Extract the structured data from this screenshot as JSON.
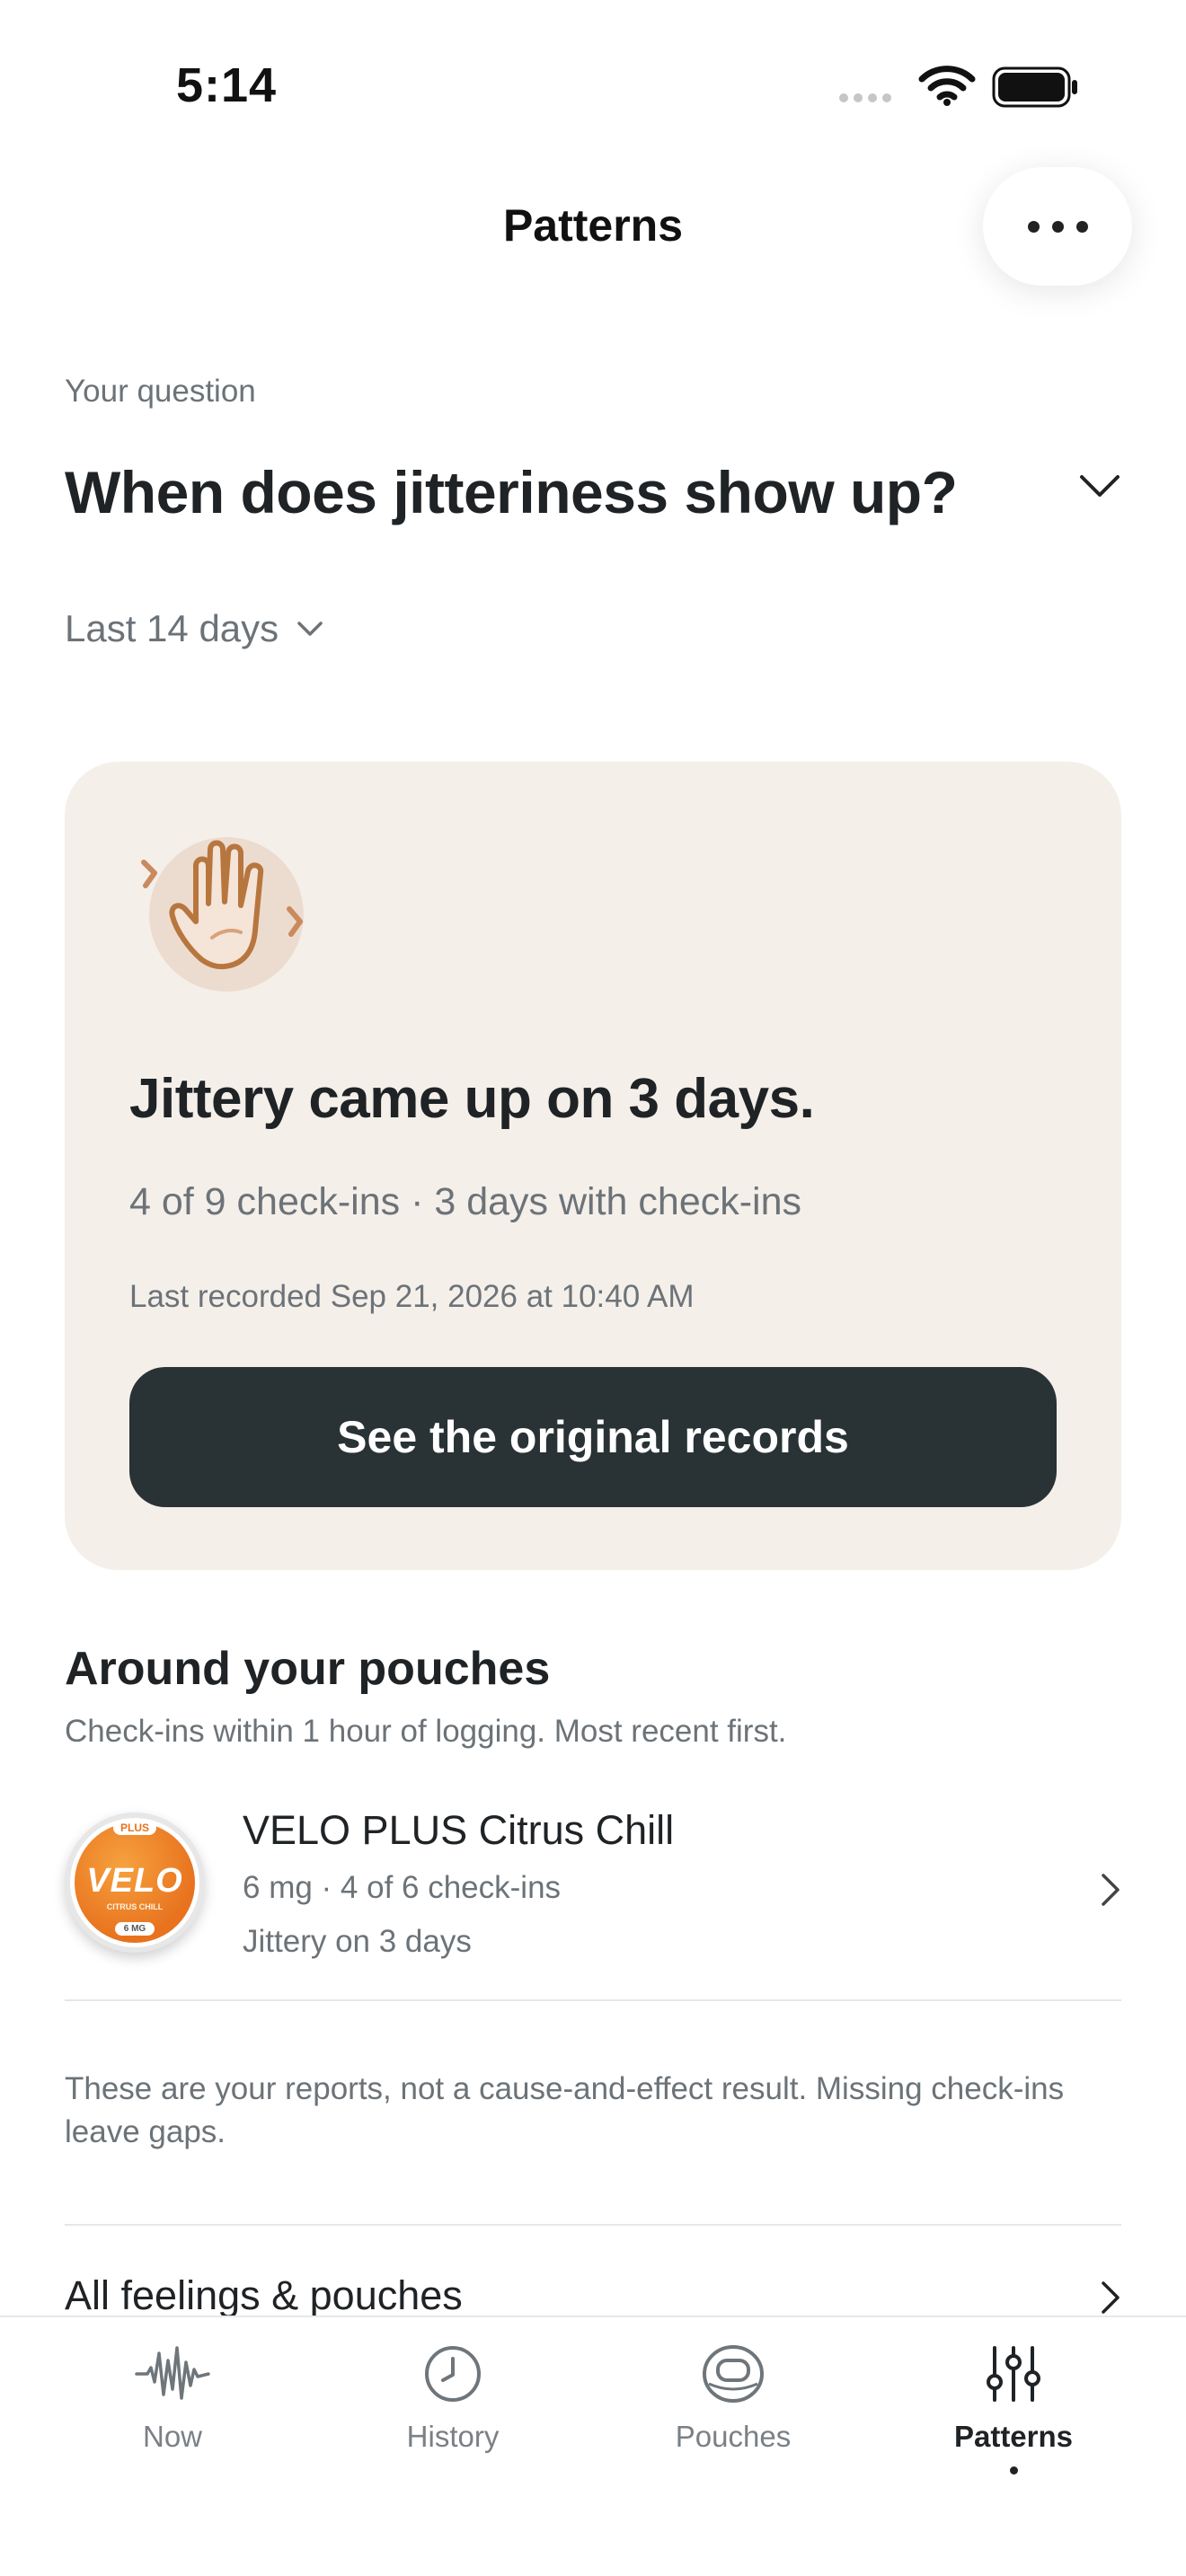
{
  "status_bar": {
    "time": "5:14"
  },
  "nav": {
    "title": "Patterns",
    "more_icon": "ellipsis-icon"
  },
  "question": {
    "label": "Your question",
    "text": "When does jitteriness show up?"
  },
  "range": {
    "label": "Last 14 days"
  },
  "summary": {
    "icon": "hand-jitter-icon",
    "title": "Jittery came up on 3 days.",
    "stats": "4 of 9 check-ins · 3 days with check-ins",
    "last_recorded": "Last recorded Sep 21, 2026 at 10:40 AM",
    "button_label": "See the original records"
  },
  "around_pouches": {
    "title": "Around your pouches",
    "subtitle": "Check-ins within 1 hour of logging. Most recent first.",
    "items": [
      {
        "name": "VELO PLUS Citrus Chill",
        "meta": "6 mg · 4 of 6 check-ins",
        "feeling": "Jittery on 3 days",
        "can": {
          "badge": "PLUS",
          "brand": "VELO",
          "flavor": "CITRUS CHILL",
          "strength": "6 MG"
        }
      }
    ]
  },
  "disclaimer": "These are your reports, not a cause-and-effect result. Missing check-ins leave gaps.",
  "all_link": {
    "label": "All feelings & pouches"
  },
  "tabs": [
    {
      "label": "Now",
      "icon": "waveform-icon",
      "active": false
    },
    {
      "label": "History",
      "icon": "clock-icon",
      "active": false
    },
    {
      "label": "Pouches",
      "icon": "pouch-icon",
      "active": false
    },
    {
      "label": "Patterns",
      "icon": "sliders-icon",
      "active": true
    }
  ],
  "colors": {
    "card_bg": "#f5efea",
    "button_bg": "#293235",
    "accent_orange": "#e8721e"
  }
}
